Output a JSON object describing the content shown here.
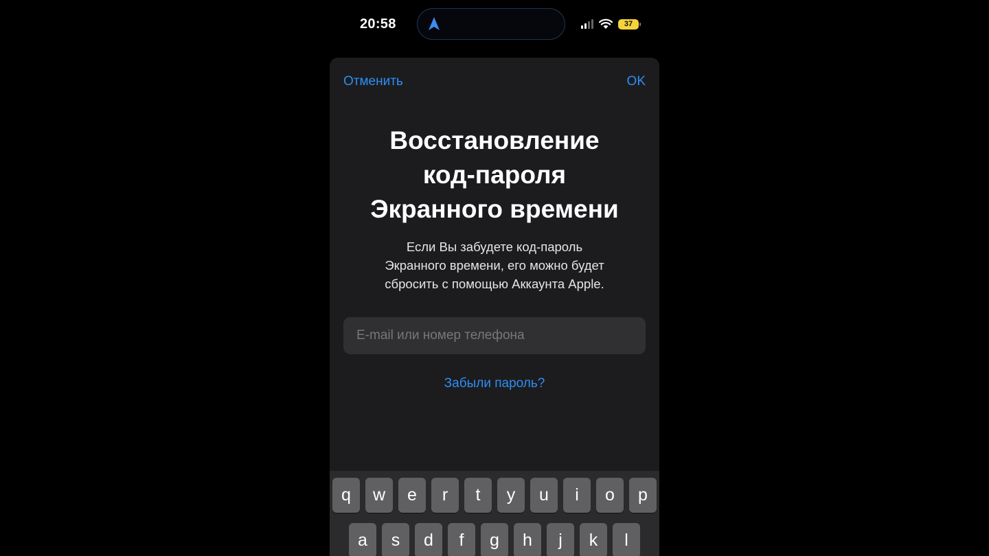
{
  "status_bar": {
    "time": "20:58",
    "battery_level": "37",
    "battery_color": "#f5d33a",
    "icons": [
      "location-arrow-icon",
      "cellular-signal-icon",
      "wifi-icon",
      "battery-icon"
    ]
  },
  "sheet": {
    "cancel_label": "Отменить",
    "ok_label": "OK",
    "title_lines": [
      "Восстановление",
      "код-пароля",
      "Экранного времени"
    ],
    "description_lines": [
      "Если Вы забудете код-пароль",
      "Экранного времени, его можно будет",
      "сбросить с помощью Аккаунта Apple."
    ],
    "input_value": "",
    "input_placeholder": "E-mail или номер телефона",
    "forgot_label": "Забыли пароль?"
  },
  "keyboard": {
    "row1": [
      "q",
      "w",
      "e",
      "r",
      "t",
      "y",
      "u",
      "i",
      "o",
      "p"
    ],
    "row2": [
      "a",
      "s",
      "d",
      "f",
      "g",
      "h",
      "j",
      "k",
      "l"
    ]
  },
  "colors": {
    "accent": "#2e8ef5",
    "sheet_background": "#1c1c1e",
    "key_background": "#606063"
  }
}
